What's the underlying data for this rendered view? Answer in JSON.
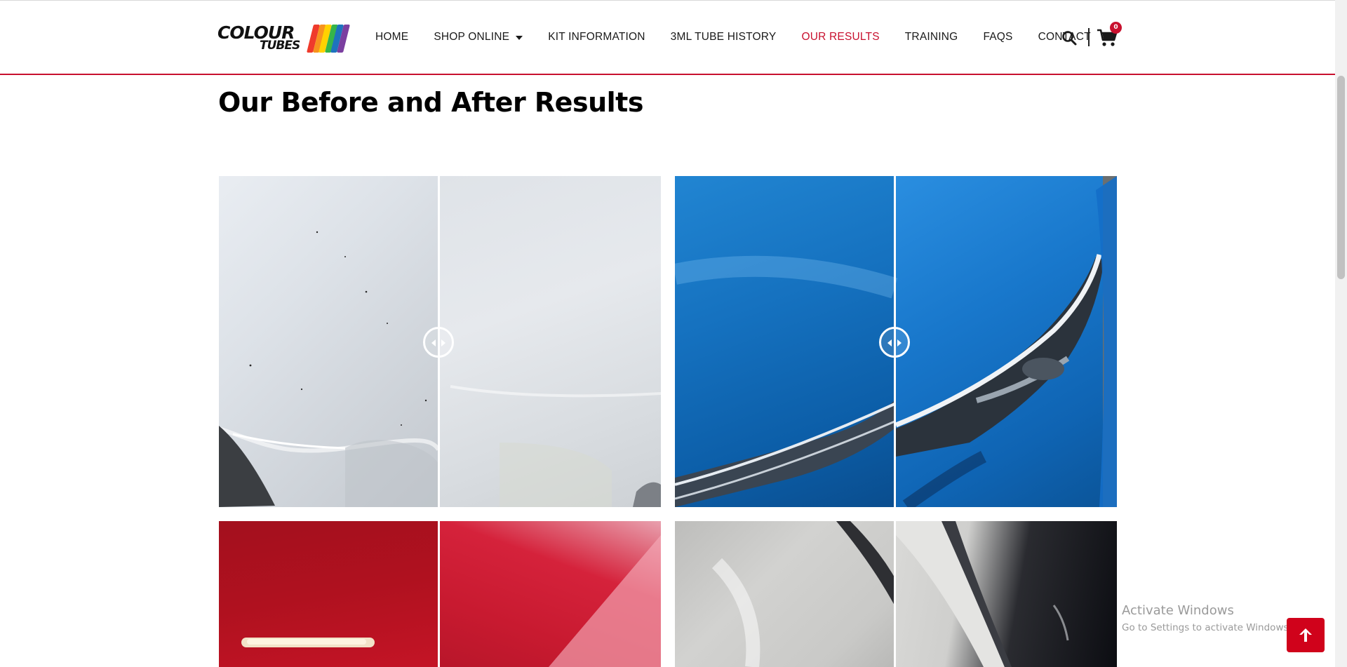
{
  "brand": {
    "logo_line1": "COLOUR",
    "logo_line2": "TUBES",
    "stripe_colors": [
      "#ef3b2c",
      "#f7931e",
      "#ffd200",
      "#35b54a",
      "#1e73be",
      "#7b3fa0"
    ]
  },
  "nav": {
    "items": [
      {
        "label": "HOME",
        "active": false,
        "has_dropdown": false
      },
      {
        "label": "SHOP ONLINE",
        "active": false,
        "has_dropdown": true
      },
      {
        "label": "KIT INFORMATION",
        "active": false,
        "has_dropdown": false
      },
      {
        "label": "3ML TUBE HISTORY",
        "active": false,
        "has_dropdown": false
      },
      {
        "label": "OUR RESULTS",
        "active": true,
        "has_dropdown": false
      },
      {
        "label": "TRAINING",
        "active": false,
        "has_dropdown": false
      },
      {
        "label": "FAQS",
        "active": false,
        "has_dropdown": false
      },
      {
        "label": "CONTACT",
        "active": false,
        "has_dropdown": false
      }
    ],
    "search_icon": "search-icon",
    "cart_icon": "cart-icon",
    "cart_count": "0"
  },
  "page": {
    "title": "Our Before and After Results"
  },
  "comparisons": [
    {
      "subject": "white car bonnet",
      "handle_icon": "left-right-arrows-icon"
    },
    {
      "subject": "blue car headlight",
      "handle_icon": "left-right-arrows-icon"
    },
    {
      "subject": "red car panel"
    },
    {
      "subject": "grey car door"
    }
  ],
  "watermark": {
    "line1": "Activate Windows",
    "line2": "Go to Settings to activate Windows."
  },
  "back_to_top_icon": "arrow-up-icon",
  "colors": {
    "accent": "#c8102e",
    "back_to_top": "#d0021b",
    "text": "#1a1a1a"
  }
}
